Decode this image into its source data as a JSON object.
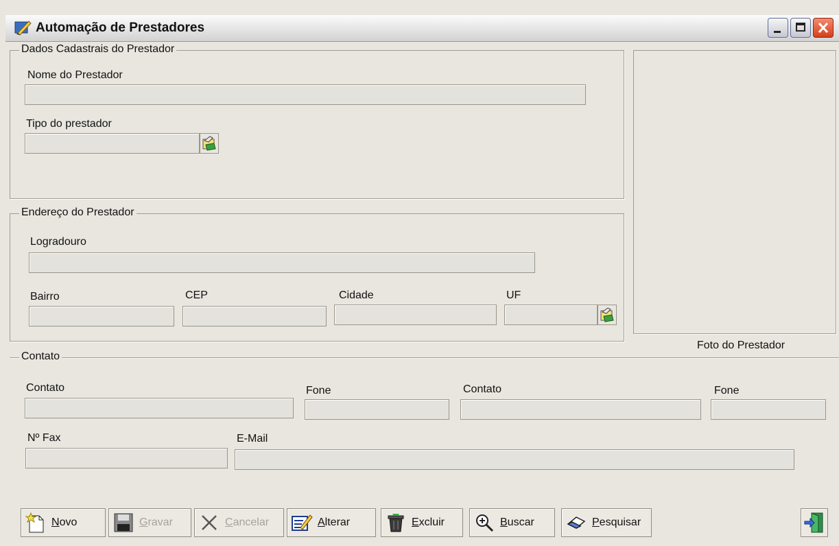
{
  "window": {
    "title": "Automação de Prestadores"
  },
  "dados": {
    "legend": "Dados Cadastrais do Prestador",
    "nome_label": "Nome do Prestador",
    "nome_value": "",
    "tipo_label": "Tipo do prestador",
    "tipo_value": ""
  },
  "endereco": {
    "legend": "Endereço do Prestador",
    "logradouro_label": "Logradouro",
    "bairro_label": "Bairro",
    "cep_label": "CEP",
    "cidade_label": "Cidade",
    "uf_label": "UF"
  },
  "foto": {
    "caption": "Foto do Prestador"
  },
  "contato": {
    "legend": "Contato",
    "contato1_label": "Contato",
    "fone1_label": "Fone",
    "contato2_label": "Contato",
    "fone2_label": "Fone",
    "fax_label": "Nº Fax",
    "email_label": "E-Mail"
  },
  "toolbar": {
    "novo": {
      "first": "N",
      "rest": "ovo",
      "enabled": true,
      "icon": "new-document-icon"
    },
    "gravar": {
      "first": "G",
      "rest": "ravar",
      "enabled": false,
      "icon": "floppy-disk-icon"
    },
    "cancelar": {
      "first": "C",
      "rest": "ancelar",
      "enabled": false,
      "icon": "x-cancel-icon"
    },
    "alterar": {
      "first": "A",
      "rest": "lterar",
      "enabled": true,
      "icon": "edit-pencil-icon"
    },
    "excluir": {
      "first": "E",
      "rest": "xcluir",
      "enabled": true,
      "icon": "trash-bin-icon"
    },
    "buscar": {
      "first": "B",
      "rest": "uscar",
      "enabled": true,
      "icon": "magnifier-icon"
    },
    "pesquisar": {
      "first": "P",
      "rest": "esquisar",
      "enabled": true,
      "icon": "eraser-icon"
    },
    "sair": {
      "icon": "exit-door-icon"
    }
  },
  "colors": {
    "window_bg": "#e8e6df",
    "close_button": "#d3401c"
  }
}
